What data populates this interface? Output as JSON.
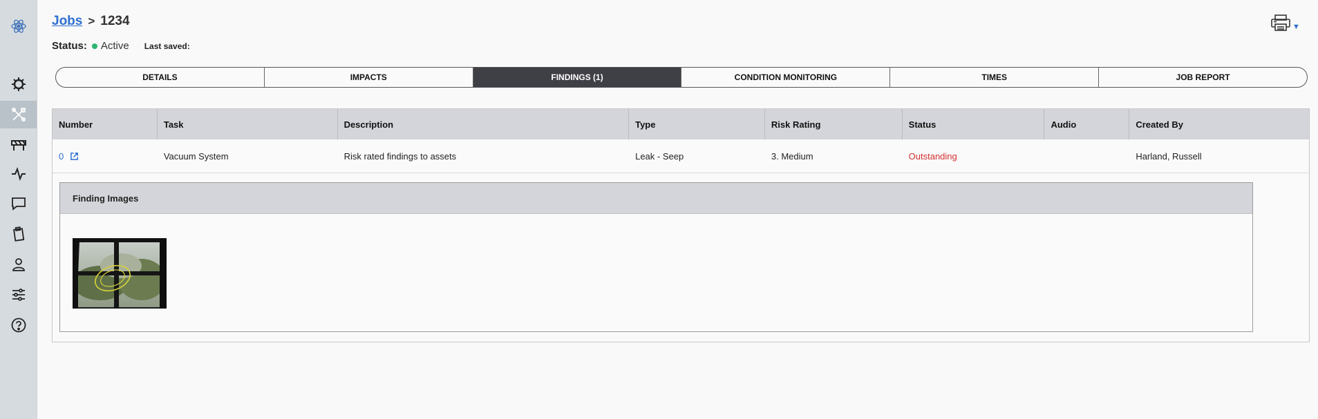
{
  "sidebar": {
    "items": [
      {
        "icon": "atom-logo-icon"
      },
      {
        "icon": "virus-icon"
      },
      {
        "icon": "tools-icon",
        "active": true
      },
      {
        "icon": "barrier-icon"
      },
      {
        "icon": "pulse-icon"
      },
      {
        "icon": "chat-icon"
      },
      {
        "icon": "clipboard-icon"
      },
      {
        "icon": "user-icon"
      },
      {
        "icon": "sliders-icon"
      },
      {
        "icon": "help-icon"
      }
    ]
  },
  "header": {
    "breadcrumb_link": "Jobs",
    "breadcrumb_sep": ">",
    "job_id": "1234",
    "status_label": "Status:",
    "status_value": "Active",
    "last_saved_label": "Last saved:"
  },
  "tabs": [
    {
      "label": "DETAILS"
    },
    {
      "label": "IMPACTS"
    },
    {
      "label": "FINDINGS (1)",
      "active": true
    },
    {
      "label": "CONDITION MONITORING"
    },
    {
      "label": "TIMES"
    },
    {
      "label": "JOB REPORT"
    }
  ],
  "findings": {
    "columns": [
      "Number",
      "Task",
      "Description",
      "Type",
      "Risk Rating",
      "Status",
      "Audio",
      "Created By"
    ],
    "rows": [
      {
        "number": "0",
        "task": "Vacuum System",
        "description": "Risk rated findings to assets",
        "type": "Leak - Seep",
        "risk_rating": "3. Medium",
        "status": "Outstanding",
        "audio": "",
        "created_by": "Harland, Russell"
      }
    ],
    "images_panel_title": "Finding Images"
  },
  "colors": {
    "accent": "#2e6fd1",
    "active_tab": "#3f3f46",
    "status_active": "#2bb673",
    "status_outstanding": "#d32f2f"
  }
}
